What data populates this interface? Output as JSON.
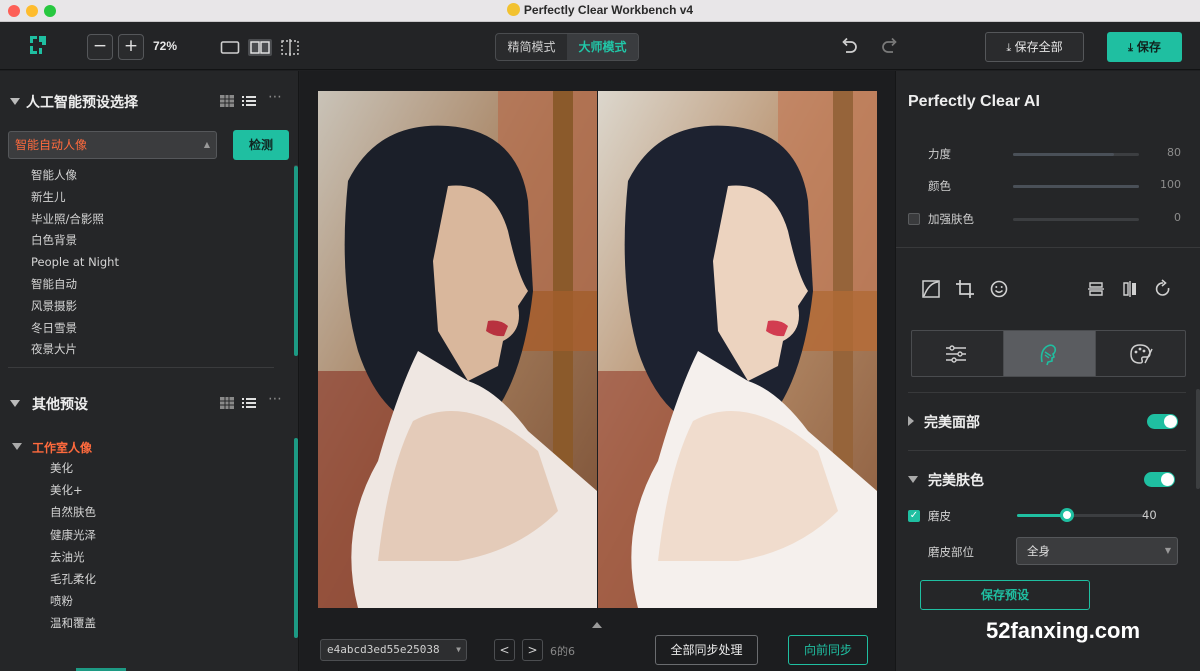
{
  "window": {
    "title": "Perfectly Clear Workbench v4"
  },
  "toolbar": {
    "zoom_out": "−",
    "zoom_in": "+",
    "zoom_level": "72%",
    "mode_simple": "精简模式",
    "mode_master": "大师模式",
    "save_all": "保存全部",
    "save": "保存"
  },
  "left": {
    "ai_section_title": "人工智能预设选择",
    "selected_preset": "智能自动人像",
    "detect_button": "检测",
    "ai_presets": [
      "智能人像",
      "新生儿",
      "毕业照/合影照",
      "白色背景",
      "People at Night",
      "智能自动",
      "风景摄影",
      "冬日雪景",
      "夜景大片"
    ],
    "other_section_title": "其他预设",
    "other_group": "工作室人像",
    "other_presets": [
      "美化",
      "美化+",
      "自然肤色",
      "健康光泽",
      "去油光",
      "毛孔柔化",
      "喷粉",
      "温和覆盖"
    ]
  },
  "center": {
    "file_name": "e4abcd3ed55e25038",
    "prev": "<",
    "next": ">",
    "page_count": "6的6",
    "sync_all": "全部同步处理",
    "sync_forward": "向前同步"
  },
  "right": {
    "title": "Perfectly Clear AI",
    "sliders": [
      {
        "label": "力度",
        "value": "80",
        "level": 0.8
      },
      {
        "label": "颜色",
        "value": "100",
        "level": 1.0
      },
      {
        "label": "加强肤色",
        "value": "0",
        "level": 0
      }
    ],
    "perfect_face": "完美面部",
    "perfect_skin": "完美肤色",
    "smooth_label": "磨皮",
    "smooth_value": "40",
    "smooth_level": 0.4,
    "smooth_area_label": "磨皮部位",
    "smooth_area_value": "全身",
    "save_preset": "保存预设"
  },
  "watermark": "52fanxing.com",
  "colors": {
    "accent": "#1fbfa1",
    "highlight": "#ff6a3d"
  }
}
